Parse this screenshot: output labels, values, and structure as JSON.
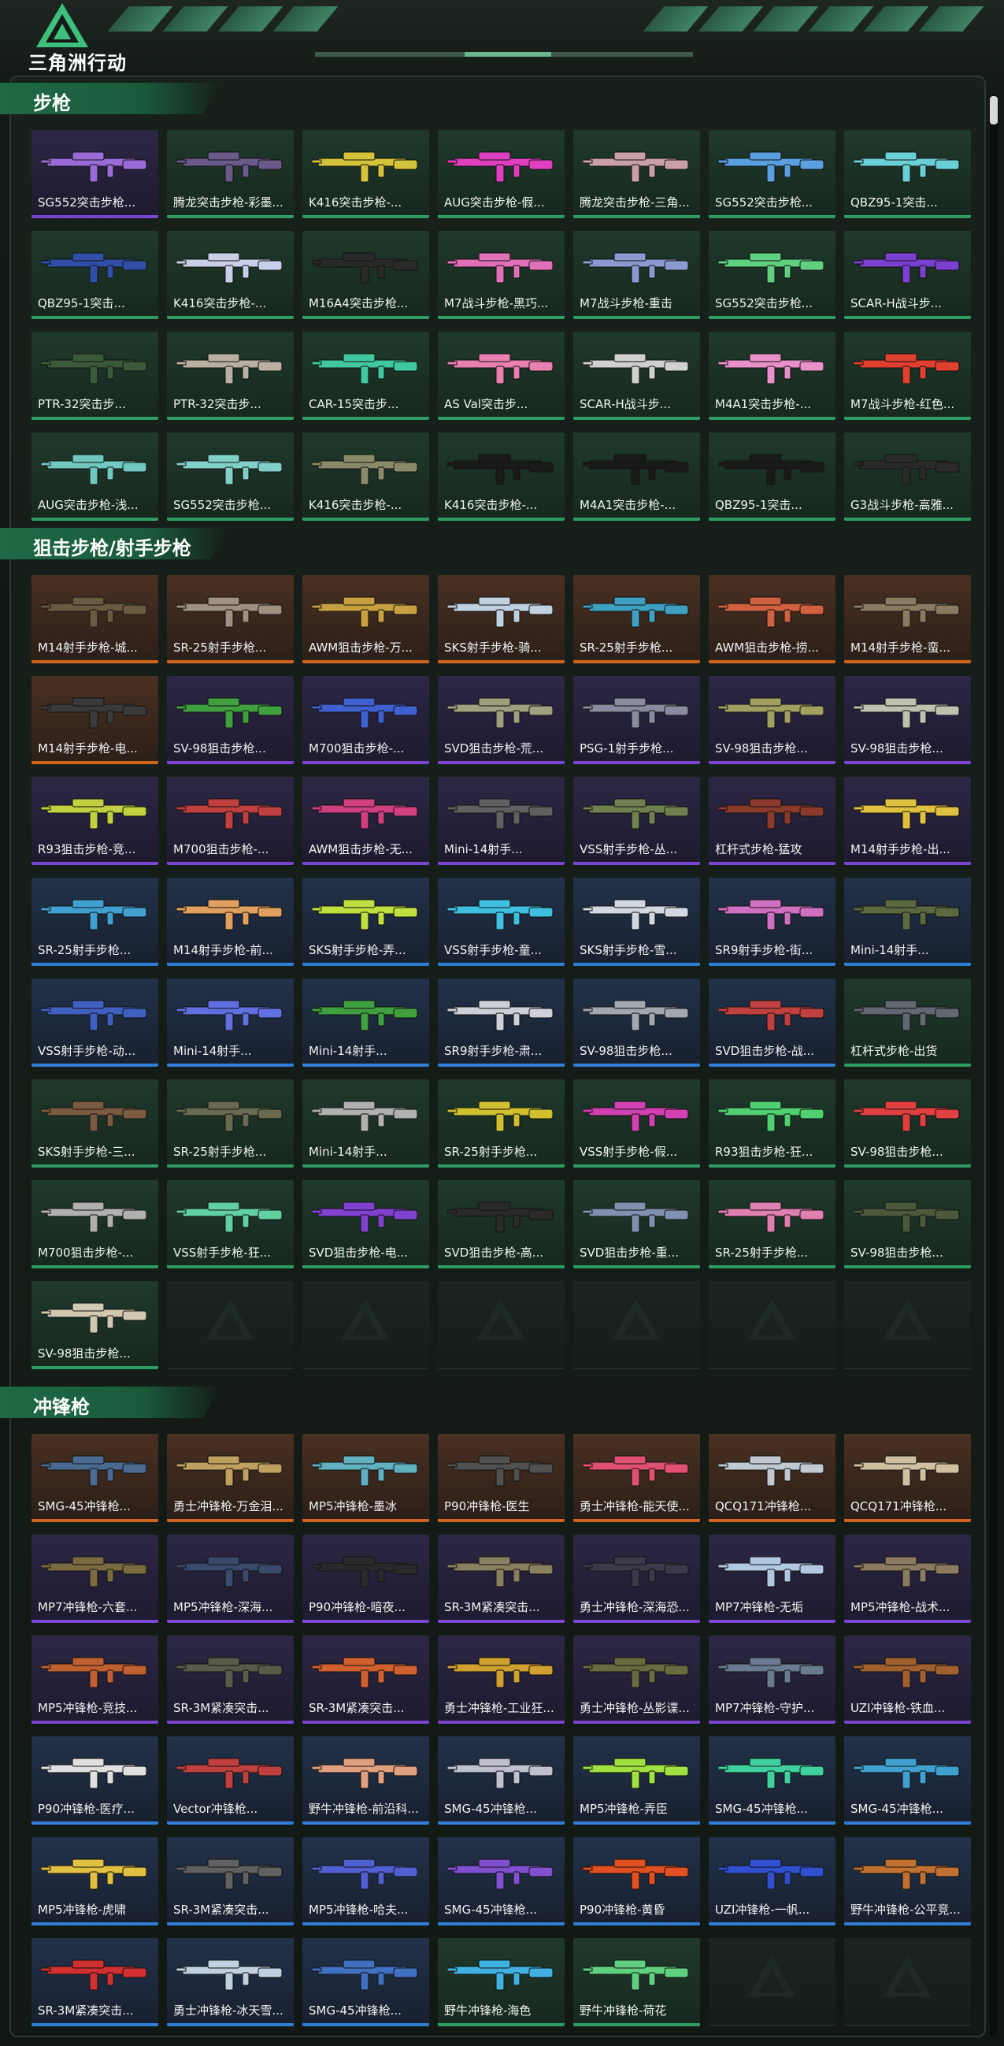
{
  "brand": {
    "title": "三角洲行动"
  },
  "colors": {
    "accent": "#3fbf7c",
    "green": "#2f9d63",
    "orange": "#d0641c",
    "purple": "#7a45d0",
    "blue": "#2f7fd6"
  },
  "sections": [
    {
      "title": "步枪",
      "items": [
        {
          "name": "SG552突击步枪...",
          "rarity": "purple",
          "color": "#9a6ad8"
        },
        {
          "name": "腾龙突击步枪-彩墨...",
          "rarity": "green",
          "color": "#6a5a8a"
        },
        {
          "name": "K416突击步枪-...",
          "rarity": "green",
          "color": "#d4c23a"
        },
        {
          "name": "AUG突击步枪-假...",
          "rarity": "green",
          "color": "#e040c0"
        },
        {
          "name": "腾龙突击步枪-三角...",
          "rarity": "green",
          "color": "#c9a0a6"
        },
        {
          "name": "SG552突击步枪...",
          "rarity": "green",
          "color": "#5aa0e0"
        },
        {
          "name": "QBZ95-1突击...",
          "rarity": "green",
          "color": "#6ad0d8"
        },
        {
          "name": "QBZ95-1突击...",
          "rarity": "green",
          "color": "#3050a8"
        },
        {
          "name": "K416突击步枪-...",
          "rarity": "green",
          "color": "#c8d0e8"
        },
        {
          "name": "M16A4突击步枪...",
          "rarity": "green",
          "color": "#2a2a2a"
        },
        {
          "name": "M7战斗步枪-黑巧...",
          "rarity": "green",
          "color": "#e070b8"
        },
        {
          "name": "M7战斗步枪-重击",
          "rarity": "green",
          "color": "#8a9ad0"
        },
        {
          "name": "SG552突击步枪...",
          "rarity": "green",
          "color": "#60d080"
        },
        {
          "name": "SCAR-H战斗步...",
          "rarity": "green",
          "color": "#7a40d0"
        },
        {
          "name": "PTR-32突击步...",
          "rarity": "green",
          "color": "#3a5a3a"
        },
        {
          "name": "PTR-32突击步...",
          "rarity": "green",
          "color": "#b8b0a0"
        },
        {
          "name": "CAR-15突击步...",
          "rarity": "green",
          "color": "#40c8a0"
        },
        {
          "name": "AS Val突击步...",
          "rarity": "green",
          "color": "#e880b0"
        },
        {
          "name": "SCAR-H战斗步...",
          "rarity": "green",
          "color": "#d0d0d0"
        },
        {
          "name": "M4A1突击步枪-...",
          "rarity": "green",
          "color": "#e890c8"
        },
        {
          "name": "M7战斗步枪-红色...",
          "rarity": "green",
          "color": "#e04030"
        },
        {
          "name": "AUG突击步枪-浅...",
          "rarity": "green",
          "color": "#70c8c0"
        },
        {
          "name": "SG552突击步枪...",
          "rarity": "green",
          "color": "#80d0c8"
        },
        {
          "name": "K416突击步枪-...",
          "rarity": "green",
          "color": "#8a8a6a"
        },
        {
          "name": "K416突击步枪-...",
          "rarity": "green",
          "color": "#1a1a1a"
        },
        {
          "name": "M4A1突击步枪-...",
          "rarity": "green",
          "color": "#1a1a1a"
        },
        {
          "name": "QBZ95-1突击...",
          "rarity": "green",
          "color": "#1a1a1a"
        },
        {
          "name": "G3战斗步枪-高雅...",
          "rarity": "green",
          "color": "#2a2a2a"
        }
      ]
    },
    {
      "title": "狙击步枪/射手步枪",
      "items": [
        {
          "name": "M14射手步枪-城...",
          "rarity": "orange",
          "color": "#6a5a40"
        },
        {
          "name": "SR-25射手步枪...",
          "rarity": "orange",
          "color": "#a09080"
        },
        {
          "name": "AWM狙击步枪-万...",
          "rarity": "orange",
          "color": "#c8a040"
        },
        {
          "name": "SKS射手步枪-骑...",
          "rarity": "orange",
          "color": "#c0d0e0"
        },
        {
          "name": "SR-25射手步枪...",
          "rarity": "orange",
          "color": "#40a0c0"
        },
        {
          "name": "AWM狙击步枪-捞...",
          "rarity": "orange",
          "color": "#d06040"
        },
        {
          "name": "M14射手步枪-蛮...",
          "rarity": "orange",
          "color": "#8a7a60"
        },
        {
          "name": "M14射手步枪-电...",
          "rarity": "orange",
          "color": "#3a3a3a"
        },
        {
          "name": "SV-98狙击步枪...",
          "rarity": "purple",
          "color": "#40a040"
        },
        {
          "name": "M700狙击步枪-...",
          "rarity": "purple",
          "color": "#4060d0"
        },
        {
          "name": "SVD狙击步枪-荒...",
          "rarity": "purple",
          "color": "#a0a080"
        },
        {
          "name": "PSG-1射手步枪...",
          "rarity": "purple",
          "color": "#8a8aa0"
        },
        {
          "name": "SV-98狙击步枪...",
          "rarity": "purple",
          "color": "#a0a060"
        },
        {
          "name": "SV-98狙击步枪...",
          "rarity": "purple",
          "color": "#c0c0b0"
        },
        {
          "name": "R93狙击步枪-竞...",
          "rarity": "purple",
          "color": "#c0d040"
        },
        {
          "name": "M700狙击步枪-...",
          "rarity": "purple",
          "color": "#c04040"
        },
        {
          "name": "AWM狙击步枪-无...",
          "rarity": "purple",
          "color": "#d04080"
        },
        {
          "name": "Mini-14射手...",
          "rarity": "purple",
          "color": "#606060"
        },
        {
          "name": "VSS射手步枪-丛...",
          "rarity": "purple",
          "color": "#708050"
        },
        {
          "name": "杠杆式步枪-猛攻",
          "rarity": "purple",
          "color": "#8a3a2a"
        },
        {
          "name": "M14射手步枪-出...",
          "rarity": "purple",
          "color": "#e0c040"
        },
        {
          "name": "SR-25射手步枪...",
          "rarity": "blue",
          "color": "#40a0d0"
        },
        {
          "name": "M14射手步枪-前...",
          "rarity": "blue",
          "color": "#e0a060"
        },
        {
          "name": "SKS射手步枪-弄...",
          "rarity": "blue",
          "color": "#c0e040"
        },
        {
          "name": "VSS射手步枪-童...",
          "rarity": "blue",
          "color": "#40c0e0"
        },
        {
          "name": "SKS射手步枪-雪...",
          "rarity": "blue",
          "color": "#d0d8e0"
        },
        {
          "name": "SR9射手步枪-街...",
          "rarity": "blue",
          "color": "#d070c0"
        },
        {
          "name": "Mini-14射手...",
          "rarity": "blue",
          "color": "#5a6a40"
        },
        {
          "name": "VSS射手步枪-动...",
          "rarity": "blue",
          "color": "#4060c0"
        },
        {
          "name": "Mini-14射手...",
          "rarity": "blue",
          "color": "#6070e0"
        },
        {
          "name": "Mini-14射手...",
          "rarity": "blue",
          "color": "#40a040"
        },
        {
          "name": "SR9射手步枪-肃...",
          "rarity": "blue",
          "color": "#d0d0d8"
        },
        {
          "name": "SV-98狙击步枪...",
          "rarity": "blue",
          "color": "#a0a8b0"
        },
        {
          "name": "SVD狙击步枪-战...",
          "rarity": "blue",
          "color": "#c04040"
        },
        {
          "name": "杠杆式步枪-出货",
          "rarity": "green",
          "color": "#606870"
        },
        {
          "name": "SKS射手步枪-三...",
          "rarity": "green",
          "color": "#7a5a40"
        },
        {
          "name": "SR-25射手步枪...",
          "rarity": "green",
          "color": "#6a6a50"
        },
        {
          "name": "Mini-14射手...",
          "rarity": "green",
          "color": "#b0b0b0"
        },
        {
          "name": "SR-25射手步枪...",
          "rarity": "green",
          "color": "#d0c030"
        },
        {
          "name": "VSS射手步枪-假...",
          "rarity": "green",
          "color": "#d040b0"
        },
        {
          "name": "R93狙击步枪-狂...",
          "rarity": "green",
          "color": "#50d070"
        },
        {
          "name": "SV-98狙击步枪...",
          "rarity": "green",
          "color": "#e04040"
        },
        {
          "name": "M700狙击步枪-...",
          "rarity": "green",
          "color": "#b0b0b0"
        },
        {
          "name": "VSS射手步枪-狂...",
          "rarity": "green",
          "color": "#60d0a0"
        },
        {
          "name": "SVD狙击步枪-电...",
          "rarity": "green",
          "color": "#8040d0"
        },
        {
          "name": "SVD狙击步枪-高...",
          "rarity": "green",
          "color": "#2a2a2a"
        },
        {
          "name": "SVD狙击步枪-重...",
          "rarity": "green",
          "color": "#8090b0"
        },
        {
          "name": "SR-25射手步枪...",
          "rarity": "green",
          "color": "#e080b0"
        },
        {
          "name": "SV-98狙击步枪...",
          "rarity": "green",
          "color": "#4a5a3a"
        },
        {
          "name": "SV-98狙击步枪...",
          "rarity": "green",
          "color": "#d0c8b0"
        }
      ],
      "empty_slots": 6
    },
    {
      "title": "冲锋枪",
      "items": [
        {
          "name": "SMG-45冲锋枪...",
          "rarity": "orange",
          "color": "#4a6a90"
        },
        {
          "name": "勇士冲锋枪-万金泪...",
          "rarity": "orange",
          "color": "#c0a060"
        },
        {
          "name": "MP5冲锋枪-墨冰",
          "rarity": "orange",
          "color": "#60b0c0"
        },
        {
          "name": "P90冲锋枪-医生",
          "rarity": "orange",
          "color": "#505050"
        },
        {
          "name": "勇士冲锋枪-能天使...",
          "rarity": "orange",
          "color": "#e05070"
        },
        {
          "name": "QCQ171冲锋枪...",
          "rarity": "orange",
          "color": "#c0c8d0"
        },
        {
          "name": "QCQ171冲锋枪...",
          "rarity": "orange",
          "color": "#d0c0a0"
        },
        {
          "name": "MP7冲锋枪-六套...",
          "rarity": "purple",
          "color": "#7a6a40"
        },
        {
          "name": "MP5冲锋枪-深海...",
          "rarity": "purple",
          "color": "#3a4a6a"
        },
        {
          "name": "P90冲锋枪-暗夜...",
          "rarity": "purple",
          "color": "#2a2a2a"
        },
        {
          "name": "SR-3M紧凑突击...",
          "rarity": "purple",
          "color": "#8a8060"
        },
        {
          "name": "勇士冲锋枪-深海恐...",
          "rarity": "purple",
          "color": "#3a3a4a"
        },
        {
          "name": "MP7冲锋枪-无垢",
          "rarity": "purple",
          "color": "#b0c8e0"
        },
        {
          "name": "MP5冲锋枪-战术...",
          "rarity": "purple",
          "color": "#8a7a60"
        },
        {
          "name": "MP5冲锋枪-竞技...",
          "rarity": "purple",
          "color": "#c06030"
        },
        {
          "name": "SR-3M紧凑突击...",
          "rarity": "purple",
          "color": "#5a5a4a"
        },
        {
          "name": "SR-3M紧凑突击...",
          "rarity": "purple",
          "color": "#d06030"
        },
        {
          "name": "勇士冲锋枪-工业狂...",
          "rarity": "purple",
          "color": "#d0a030"
        },
        {
          "name": "勇士冲锋枪-丛影谍...",
          "rarity": "purple",
          "color": "#6a6a40"
        },
        {
          "name": "MP7冲锋枪-守护...",
          "rarity": "purple",
          "color": "#6a7a90"
        },
        {
          "name": "UZI冲锋枪-铁血...",
          "rarity": "purple",
          "color": "#a06030"
        },
        {
          "name": "P90冲锋枪-医疗...",
          "rarity": "blue",
          "color": "#e0e0e0"
        },
        {
          "name": "Vector冲锋枪...",
          "rarity": "blue",
          "color": "#c04040"
        },
        {
          "name": "野牛冲锋枪-前沿科...",
          "rarity": "blue",
          "color": "#e0a080"
        },
        {
          "name": "SMG-45冲锋枪...",
          "rarity": "blue",
          "color": "#c0c0d0"
        },
        {
          "name": "MP5冲锋枪-弄臣",
          "rarity": "blue",
          "color": "#a0e040"
        },
        {
          "name": "SMG-45冲锋枪...",
          "rarity": "blue",
          "color": "#40d0a0"
        },
        {
          "name": "SMG-45冲锋枪...",
          "rarity": "blue",
          "color": "#40a0d0"
        },
        {
          "name": "MP5冲锋枪-虎啸",
          "rarity": "blue",
          "color": "#e0c040"
        },
        {
          "name": "SR-3M紧凑突击...",
          "rarity": "blue",
          "color": "#606060"
        },
        {
          "name": "MP5冲锋枪-哈夫...",
          "rarity": "blue",
          "color": "#5060d0"
        },
        {
          "name": "SMG-45冲锋枪...",
          "rarity": "blue",
          "color": "#8050d0"
        },
        {
          "name": "P90冲锋枪-黄昏",
          "rarity": "blue",
          "color": "#e05020"
        },
        {
          "name": "UZI冲锋枪-一帆...",
          "rarity": "blue",
          "color": "#3050d0"
        },
        {
          "name": "野牛冲锋枪-公平竞...",
          "rarity": "blue",
          "color": "#c07030"
        },
        {
          "name": "SR-3M紧凑突击...",
          "rarity": "blue",
          "color": "#d03030"
        },
        {
          "name": "勇士冲锋枪-冰天雪...",
          "rarity": "blue",
          "color": "#c0d0e0"
        },
        {
          "name": "SMG-45冲锋枪...",
          "rarity": "blue",
          "color": "#4070c0"
        },
        {
          "name": "野牛冲锋枪-海色",
          "rarity": "green",
          "color": "#40b0e0"
        },
        {
          "name": "野牛冲锋枪-荷花",
          "rarity": "green",
          "color": "#60d080"
        }
      ],
      "empty_slots": 2
    }
  ]
}
